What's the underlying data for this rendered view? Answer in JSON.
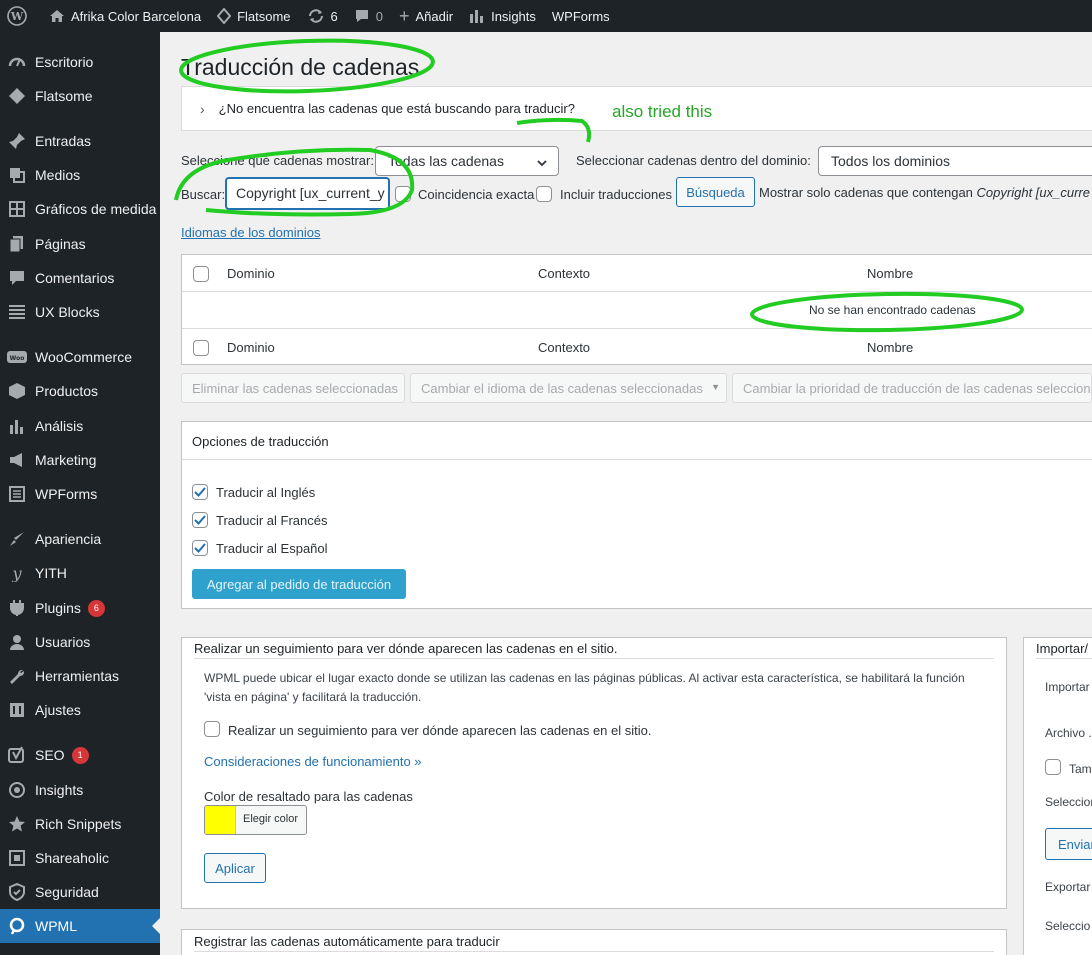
{
  "admin_bar": {
    "site_name": "Afrika Color Barcelona",
    "theme": "Flatsome",
    "updates_count": "6",
    "comments_count": "0",
    "add_new": "Añadir",
    "insights": "Insights",
    "wpforms": "WPForms"
  },
  "sidebar": {
    "items": [
      {
        "label": "Escritorio",
        "icon": "dashboard-icon"
      },
      {
        "label": "Flatsome",
        "icon": "flatsome-icon"
      },
      {
        "label": "Entradas",
        "icon": "pin-icon"
      },
      {
        "label": "Medios",
        "icon": "media-icon"
      },
      {
        "label": "Gráficos de medida",
        "icon": "grid-icon"
      },
      {
        "label": "Páginas",
        "icon": "pages-icon"
      },
      {
        "label": "Comentarios",
        "icon": "comment-icon"
      },
      {
        "label": "UX Blocks",
        "icon": "blocks-icon"
      },
      {
        "label": "WooCommerce",
        "icon": "woo-icon"
      },
      {
        "label": "Productos",
        "icon": "box-icon"
      },
      {
        "label": "Análisis",
        "icon": "bar-chart-icon"
      },
      {
        "label": "Marketing",
        "icon": "megaphone-icon"
      },
      {
        "label": "WPForms",
        "icon": "form-icon"
      },
      {
        "label": "Apariencia",
        "icon": "brush-icon"
      },
      {
        "label": "YITH",
        "icon": "yith-icon"
      },
      {
        "label": "Plugins",
        "icon": "plug-icon",
        "badge": "6"
      },
      {
        "label": "Usuarios",
        "icon": "user-icon"
      },
      {
        "label": "Herramientas",
        "icon": "wrench-icon"
      },
      {
        "label": "Ajustes",
        "icon": "settings-icon"
      },
      {
        "label": "SEO",
        "icon": "yoast-icon",
        "badge": "1"
      },
      {
        "label": "Insights",
        "icon": "insights-icon"
      },
      {
        "label": "Rich Snippets",
        "icon": "star-icon"
      },
      {
        "label": "Shareaholic",
        "icon": "share-icon"
      },
      {
        "label": "Seguridad",
        "icon": "shield-icon"
      },
      {
        "label": "WPML",
        "icon": "wpml-icon",
        "active": true
      }
    ]
  },
  "page": {
    "title": "Traducción de cadenas",
    "notice": "¿No encuentra las cadenas que está buscando para traducir?",
    "annotation": "also tried this"
  },
  "filters": {
    "select_label": "Seleccione qué cadenas mostrar:",
    "select_value": "Todas las cadenas",
    "domain_label": "Seleccionar cadenas dentro del dominio:",
    "domain_value": "Todos los dominios",
    "search_label": "Buscar:",
    "search_value": "Copyright [ux_current_y",
    "exact_match": "Coincidencia exacta",
    "include_translations": "Incluir traducciones",
    "search_button": "Búsqueda",
    "show_only": "Mostrar solo cadenas que contengan",
    "show_only_term": "Copyright [ux_curre",
    "domains_link": "Idiomas de los dominios"
  },
  "table": {
    "columns": [
      "Dominio",
      "Contexto",
      "Nombre"
    ],
    "empty_message": "No se han encontrado cadenas"
  },
  "bulk_actions": {
    "delete": "Eliminar las cadenas seleccionadas",
    "change_language": "Cambiar el idioma de las cadenas seleccionadas",
    "change_priority": "Cambiar la prioridad de traducción de las cadenas seleccion"
  },
  "translation_options": {
    "title": "Opciones de traducción",
    "languages": [
      "Traducir al Inglés",
      "Traducir al Francés",
      "Traducir al Español"
    ],
    "add_button": "Agregar al pedido de traducción"
  },
  "tracking": {
    "title": "Realizar un seguimiento para ver dónde aparecen las cadenas en el sitio.",
    "description_1": "WPML puede ubicar el lugar exacto donde se utilizan las cadenas en las páginas públicas. Al activar esta característica, se habilitará la función",
    "description_2": "'vista en página' y facilitará la traducción.",
    "checkbox_label": "Realizar un seguimiento para ver dónde aparecen las cadenas en el sitio.",
    "link": "Consideraciones de funcionamiento »",
    "color_label": "Color de resaltado para las cadenas",
    "color_button": "Elegir color",
    "highlight_color": "#ffff00",
    "apply_button": "Aplicar"
  },
  "auto_register": {
    "title": "Registrar las cadenas automáticamente para traducir"
  },
  "import_panel": {
    "title": "Importar/",
    "import_label": "Importar",
    "file_label": "Archivo .",
    "checkbox_label": "Tam",
    "select_label": "Seleccion",
    "send_button": "Enviar",
    "export_label": "Exportar",
    "select_label_2": "Seleccio"
  },
  "colors": {
    "admin_bg": "#1d2327",
    "accent": "#2271b1",
    "annotation_green": "#22cc22"
  }
}
